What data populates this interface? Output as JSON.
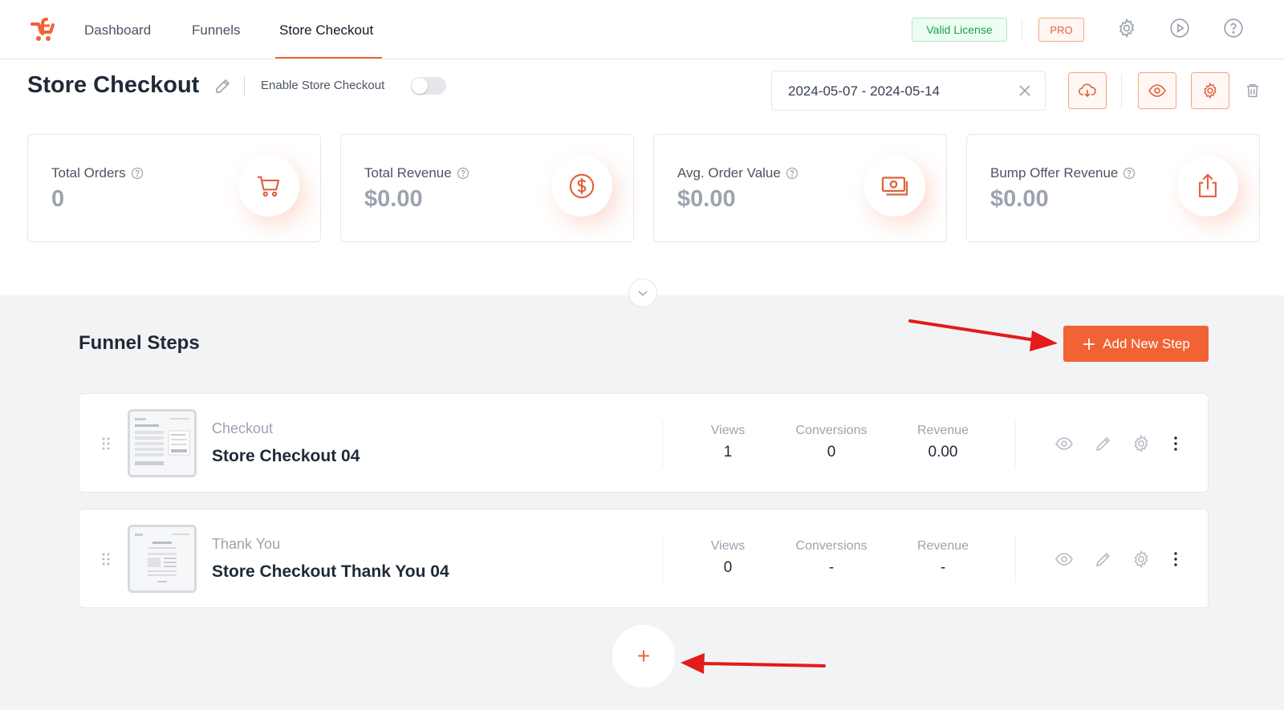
{
  "nav": {
    "items": [
      {
        "label": "Dashboard"
      },
      {
        "label": "Funnels"
      },
      {
        "label": "Store Checkout"
      }
    ],
    "active_index": 2,
    "license_badge": "Valid License",
    "pro_badge": "PRO",
    "icons": [
      "gear-icon",
      "play-icon",
      "help-icon"
    ]
  },
  "header": {
    "title": "Store Checkout",
    "enable_label": "Enable Store Checkout",
    "enabled": false,
    "date_range": "2024-05-07 - 2024-05-14",
    "actions": [
      "download-icon",
      "eye-icon",
      "gear-icon",
      "trash-icon"
    ]
  },
  "stats": [
    {
      "label": "Total Orders",
      "value": "0",
      "icon": "cart-icon"
    },
    {
      "label": "Total Revenue",
      "value": "$0.00",
      "icon": "dollar-icon"
    },
    {
      "label": "Avg. Order Value",
      "value": "$0.00",
      "icon": "cash-icon"
    },
    {
      "label": "Bump Offer Revenue",
      "value": "$0.00",
      "icon": "share-icon"
    }
  ],
  "funnel": {
    "title": "Funnel Steps",
    "add_button": "Add New Step",
    "add_plus": "+",
    "steps": [
      {
        "type": "Checkout",
        "name": "Store Checkout 04",
        "views_label": "Views",
        "views": "1",
        "conversions_label": "Conversions",
        "conversions": "0",
        "revenue_label": "Revenue",
        "revenue": "0.00"
      },
      {
        "type": "Thank You",
        "name": "Store Checkout Thank You 04",
        "views_label": "Views",
        "views": "0",
        "conversions_label": "Conversions",
        "conversions": "-",
        "revenue_label": "Revenue",
        "revenue": "-"
      }
    ]
  },
  "colors": {
    "accent": "#f16334",
    "arrow": "#e31b1b",
    "success": "#16a34a"
  }
}
